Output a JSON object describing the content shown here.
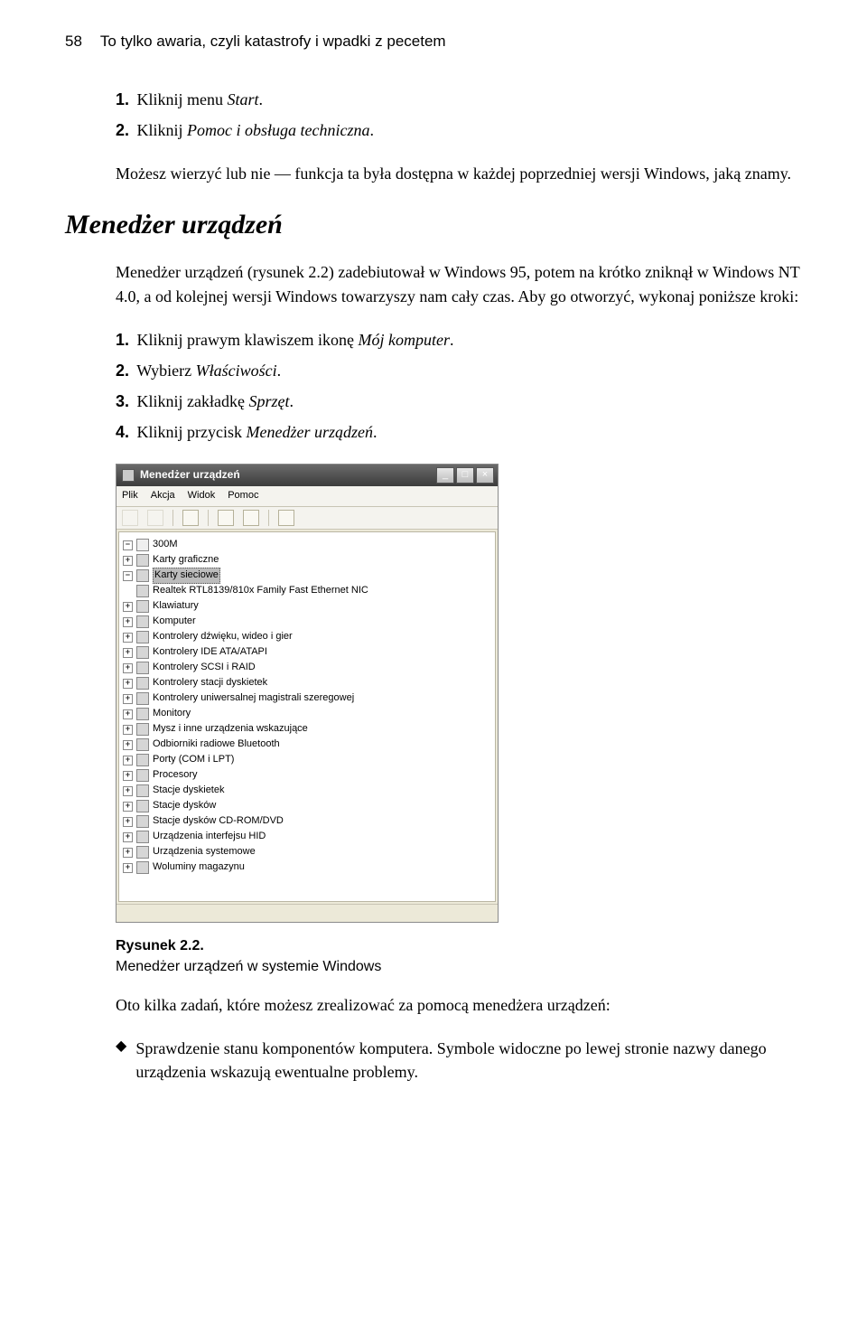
{
  "header": {
    "page": "58",
    "title": "To tylko awaria, czyli katastrofy i wpadki z pecetem"
  },
  "stepsA": [
    {
      "num": "1.",
      "text": "Kliknij menu ",
      "em": "Start",
      "after": "."
    },
    {
      "num": "2.",
      "text": "Kliknij ",
      "em": "Pomoc i obsługa techniczna",
      "after": "."
    }
  ],
  "paraA": "Możesz wierzyć lub nie — funkcja ta była dostępna w każdej poprzedniej wersji Windows, jaką znamy.",
  "sectionTitle": "Menedżer urządzeń",
  "paraB": "Menedżer urządzeń (rysunek 2.2) zadebiutował w Windows 95, potem na krótko zniknął w Windows NT 4.0, a od kolejnej wersji Windows towarzyszy nam cały czas. Aby go otworzyć, wykonaj poniższe kroki:",
  "stepsB": [
    {
      "num": "1.",
      "text": "Kliknij prawym klawiszem ikonę ",
      "em": "Mój komputer",
      "after": "."
    },
    {
      "num": "2.",
      "text": "Wybierz ",
      "em": "Właściwości",
      "after": "."
    },
    {
      "num": "3.",
      "text": "Kliknij zakładkę ",
      "em": "Sprzęt",
      "after": "."
    },
    {
      "num": "4.",
      "text": "Kliknij przycisk ",
      "em": "Menedżer urządzeń",
      "after": "."
    }
  ],
  "dialog": {
    "title": "Menedżer urządzeń",
    "menu": [
      "Plik",
      "Akcja",
      "Widok",
      "Pomoc"
    ],
    "root": "300M",
    "nodes": [
      {
        "pm": "+",
        "label": "Karty graficzne"
      },
      {
        "pm": "−",
        "label": "Karty sieciowe",
        "sel": true,
        "children": [
          {
            "label": "Realtek RTL8139/810x Family Fast Ethernet NIC"
          }
        ]
      },
      {
        "pm": "+",
        "label": "Klawiatury"
      },
      {
        "pm": "+",
        "label": "Komputer"
      },
      {
        "pm": "+",
        "label": "Kontrolery dźwięku, wideo i gier"
      },
      {
        "pm": "+",
        "label": "Kontrolery IDE ATA/ATAPI"
      },
      {
        "pm": "+",
        "label": "Kontrolery SCSI i RAID"
      },
      {
        "pm": "+",
        "label": "Kontrolery stacji dyskietek"
      },
      {
        "pm": "+",
        "label": "Kontrolery uniwersalnej magistrali szeregowej"
      },
      {
        "pm": "+",
        "label": "Monitory"
      },
      {
        "pm": "+",
        "label": "Mysz i inne urządzenia wskazujące"
      },
      {
        "pm": "+",
        "label": "Odbiorniki radiowe Bluetooth"
      },
      {
        "pm": "+",
        "label": "Porty (COM i LPT)"
      },
      {
        "pm": "+",
        "label": "Procesory"
      },
      {
        "pm": "+",
        "label": "Stacje dyskietek"
      },
      {
        "pm": "+",
        "label": "Stacje dysków"
      },
      {
        "pm": "+",
        "label": "Stacje dysków CD-ROM/DVD"
      },
      {
        "pm": "+",
        "label": "Urządzenia interfejsu HID"
      },
      {
        "pm": "+",
        "label": "Urządzenia systemowe"
      },
      {
        "pm": "+",
        "label": "Woluminy magazynu"
      }
    ]
  },
  "caption": {
    "label": "Rysunek 2.2.",
    "text": "Menedżer urządzeń w systemie Windows"
  },
  "paraC": "Oto kilka zadań, które możesz zrealizować za pomocą menedżera urządzeń:",
  "bullets": [
    "Sprawdzenie stanu komponentów komputera. Symbole widoczne po lewej stronie nazwy danego urządzenia wskazują ewentualne problemy."
  ]
}
